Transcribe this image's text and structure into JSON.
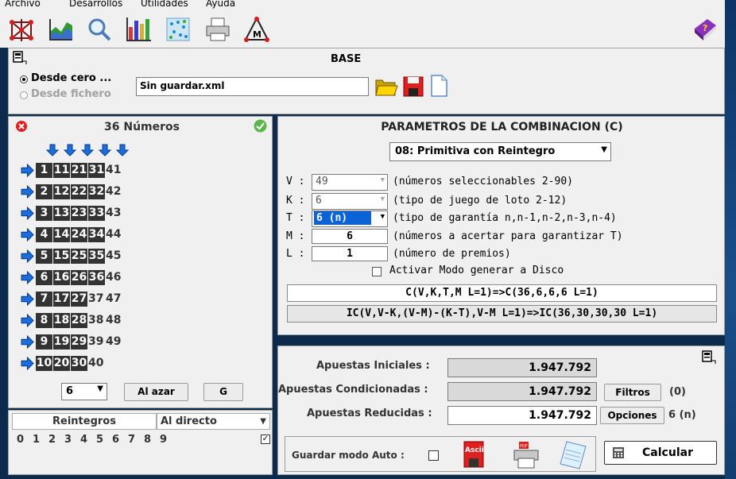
{
  "menu": {
    "items": [
      "Archivo",
      "Desarrollos",
      "Utilidades",
      "Ayuda"
    ]
  },
  "toolbar": {
    "icons": [
      "network-icon",
      "chart-area-icon",
      "magnifier-icon",
      "bar-chart-icon",
      "dot-grid-icon",
      "printer-icon",
      "triangle-m-icon",
      "help-book-icon"
    ]
  },
  "base": {
    "title": "BASE",
    "option1": "Desde cero ...",
    "option2": "Desde fichero",
    "file": "Sin guardar.xml"
  },
  "numbers": {
    "title": "36 Números",
    "rows": [
      [
        "1",
        "11",
        "21",
        "31",
        "41"
      ],
      [
        "2",
        "12",
        "22",
        "32",
        "42"
      ],
      [
        "3",
        "13",
        "23",
        "33",
        "43"
      ],
      [
        "4",
        "14",
        "24",
        "34",
        "44"
      ],
      [
        "5",
        "15",
        "25",
        "35",
        "45"
      ],
      [
        "6",
        "16",
        "26",
        "36",
        "46"
      ],
      [
        "7",
        "17",
        "27",
        "37",
        "47"
      ],
      [
        "8",
        "18",
        "28",
        "38",
        "48"
      ],
      [
        "9",
        "19",
        "29",
        "39",
        "49"
      ],
      [
        "10",
        "20",
        "30",
        "40"
      ]
    ],
    "selected_count": "6",
    "random_label": "Al azar",
    "g_label": "G"
  },
  "reintegros": {
    "header": "Reintegros",
    "mode": "Al directo",
    "digits": [
      "0",
      "1",
      "2",
      "3",
      "4",
      "5",
      "6",
      "7",
      "8",
      "9"
    ]
  },
  "params": {
    "title": "PARAMETROS DE LA COMBINACION (C)",
    "game": "08: Primitiva con Reintegro",
    "v_label": "V :",
    "v_value": "49",
    "v_desc": "(números seleccionables 2-90)",
    "k_label": "K :",
    "k_value": "6",
    "k_desc": "(tipo de juego de loto 2-12)",
    "t_label": "T :",
    "t_value": "6 (n)",
    "t_desc": "(tipo de garantía n,n-1,n-2,n-3,n-4)",
    "m_label": "M :",
    "m_value": "6",
    "m_desc": "(números a acertar para garantizar T)",
    "l_label": "L :",
    "l_value": "1",
    "l_desc": "(número de premios)",
    "disk_label": "Activar Modo generar a Disco",
    "formula1": "C(V,K,T,M L=1)=>C(36,6,6,6 L=1)",
    "formula2": "IC(V,V-K,(V-M)-(K-T),V-M L=1)=>IC(36,30,30,30 L=1)"
  },
  "results": {
    "initial_label": "Apuestas Iniciales :",
    "initial_value": "1.947.792",
    "cond_label": "Apuestas Condicionadas :",
    "cond_value": "1.947.792",
    "filters_label": "Filtros",
    "filters_count": "(0)",
    "reduced_label": "Apuestas Reducidas :",
    "reduced_value": "1.947.792",
    "options_label": "Opciones",
    "options_count": "6 (n)",
    "auto_label": "Guardar modo Auto :",
    "calc_label": "Calcular"
  }
}
